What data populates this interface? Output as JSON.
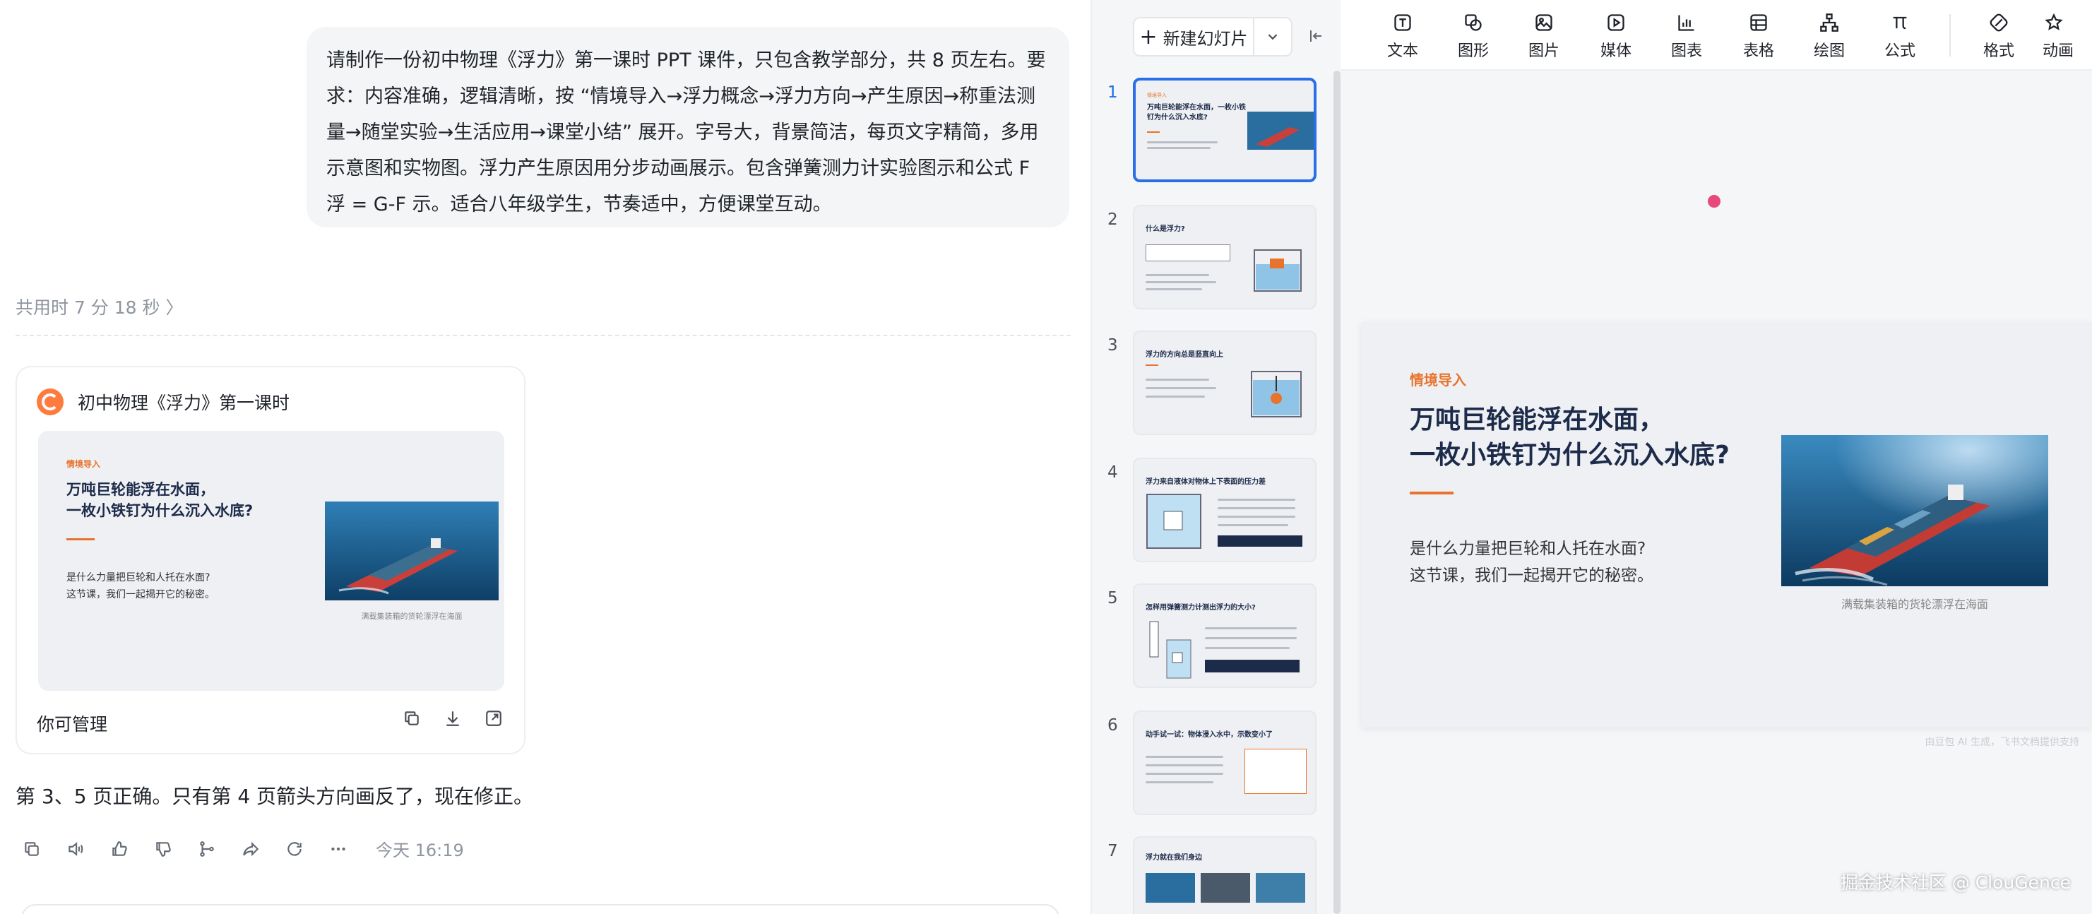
{
  "chat": {
    "user_prompt": "请制作一份初中物理《浮力》第一课时 PPT 课件，只包含教学部分，共 8 页左右。要求：内容准确，逻辑清晰，按 “情境导入→浮力概念→浮力方向→产生原因→称重法测量→随堂实验→生活应用→课堂小结” 展开。字号大，背景简洁，每页文字精简，多用示意图和实物图。浮力产生原因用分步动画展示。包含弹簧测力计实验图示和公式 F 浮 = G-F 示。适合八年级学生，节奏适中，方便课堂互动。",
    "elapsed": "共用时 7 分 18 秒 〉",
    "card": {
      "title": "初中物理《浮力》第一课时",
      "footer_label": "你可管理"
    },
    "reply": "第 3、5 页正确。只有第 4 页箭头方向画反了，现在修正。",
    "time": "今天 16:19"
  },
  "thumbs_panel": {
    "new_slide_label": "新建幻灯片",
    "slides": [
      {
        "num": "1",
        "title": "万吨巨轮能浮在水面，一枚小铁钉为什么沉入水底?"
      },
      {
        "num": "2",
        "title": "什么是浮力?"
      },
      {
        "num": "3",
        "title": "浮力的方向总是竖直向上"
      },
      {
        "num": "4",
        "title": "浮力来自液体对物体上下表面的压力差"
      },
      {
        "num": "5",
        "title": "怎样用弹簧测力计测出浮力的大小?"
      },
      {
        "num": "6",
        "title": "动手试一试：物体浸入水中，示数变小了"
      },
      {
        "num": "7",
        "title": "浮力就在我们身边"
      }
    ]
  },
  "toolbar": {
    "items": [
      {
        "label": "文本",
        "icon": "text-icon"
      },
      {
        "label": "图形",
        "icon": "shape-icon"
      },
      {
        "label": "图片",
        "icon": "image-icon"
      },
      {
        "label": "媒体",
        "icon": "media-icon"
      },
      {
        "label": "图表",
        "icon": "chart-icon"
      },
      {
        "label": "表格",
        "icon": "table-icon"
      },
      {
        "label": "绘图",
        "icon": "diagram-icon"
      },
      {
        "label": "公式",
        "icon": "formula-icon"
      },
      {
        "label": "格式",
        "icon": "format-icon"
      },
      {
        "label": "动画",
        "icon": "animation-icon"
      }
    ]
  },
  "slide": {
    "tag": "情境导入",
    "title": "万吨巨轮能浮在水面，一枚小铁钉为什么沉入水底?",
    "title_line1": "万吨巨轮能浮在水面，",
    "title_line2": "一枚小铁钉为什么沉入水底?",
    "body_line1": "是什么力量把巨轮和人托在水面?",
    "body_line2": "这节课，我们一起揭开它的秘密。",
    "caption": "满载集装箱的货轮漂浮在海面"
  },
  "gen_note": "由豆包 AI 生成，飞书文档提供支持",
  "watermark": "掘金技术社区 @ ClouGence",
  "colors": {
    "accent": "#e8732c",
    "title": "#1d2b4a",
    "active": "#2a6ee8"
  }
}
